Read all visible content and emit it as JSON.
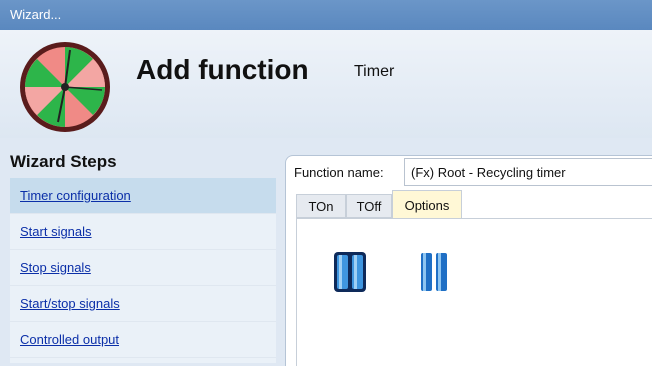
{
  "window": {
    "title": "Wizard..."
  },
  "header": {
    "title": "Add function",
    "subtitle": "Timer",
    "logo_icon": "timer-clock-icon"
  },
  "wizard": {
    "steps_title": "Wizard Steps",
    "steps": [
      {
        "label": "Timer configuration",
        "active": true
      },
      {
        "label": "Start signals"
      },
      {
        "label": "Stop signals"
      },
      {
        "label": "Start/stop signals"
      },
      {
        "label": "Controlled output"
      }
    ]
  },
  "form": {
    "function_name_label": "Function name:",
    "function_name_value": "(Fx) Root - Recycling timer"
  },
  "tabs": [
    {
      "label": "TOn"
    },
    {
      "label": "TOff"
    },
    {
      "label": "Options",
      "active": true
    }
  ],
  "options": {
    "icons": [
      "toggle-option-selected-icon",
      "toggle-option-icon"
    ]
  },
  "colors": {
    "titlebar": "#5a88bf",
    "link": "#0b2fa8",
    "active_step": "#c6dced",
    "active_tab": "#fff8d6",
    "icon_blue": "#1f6fc5"
  }
}
